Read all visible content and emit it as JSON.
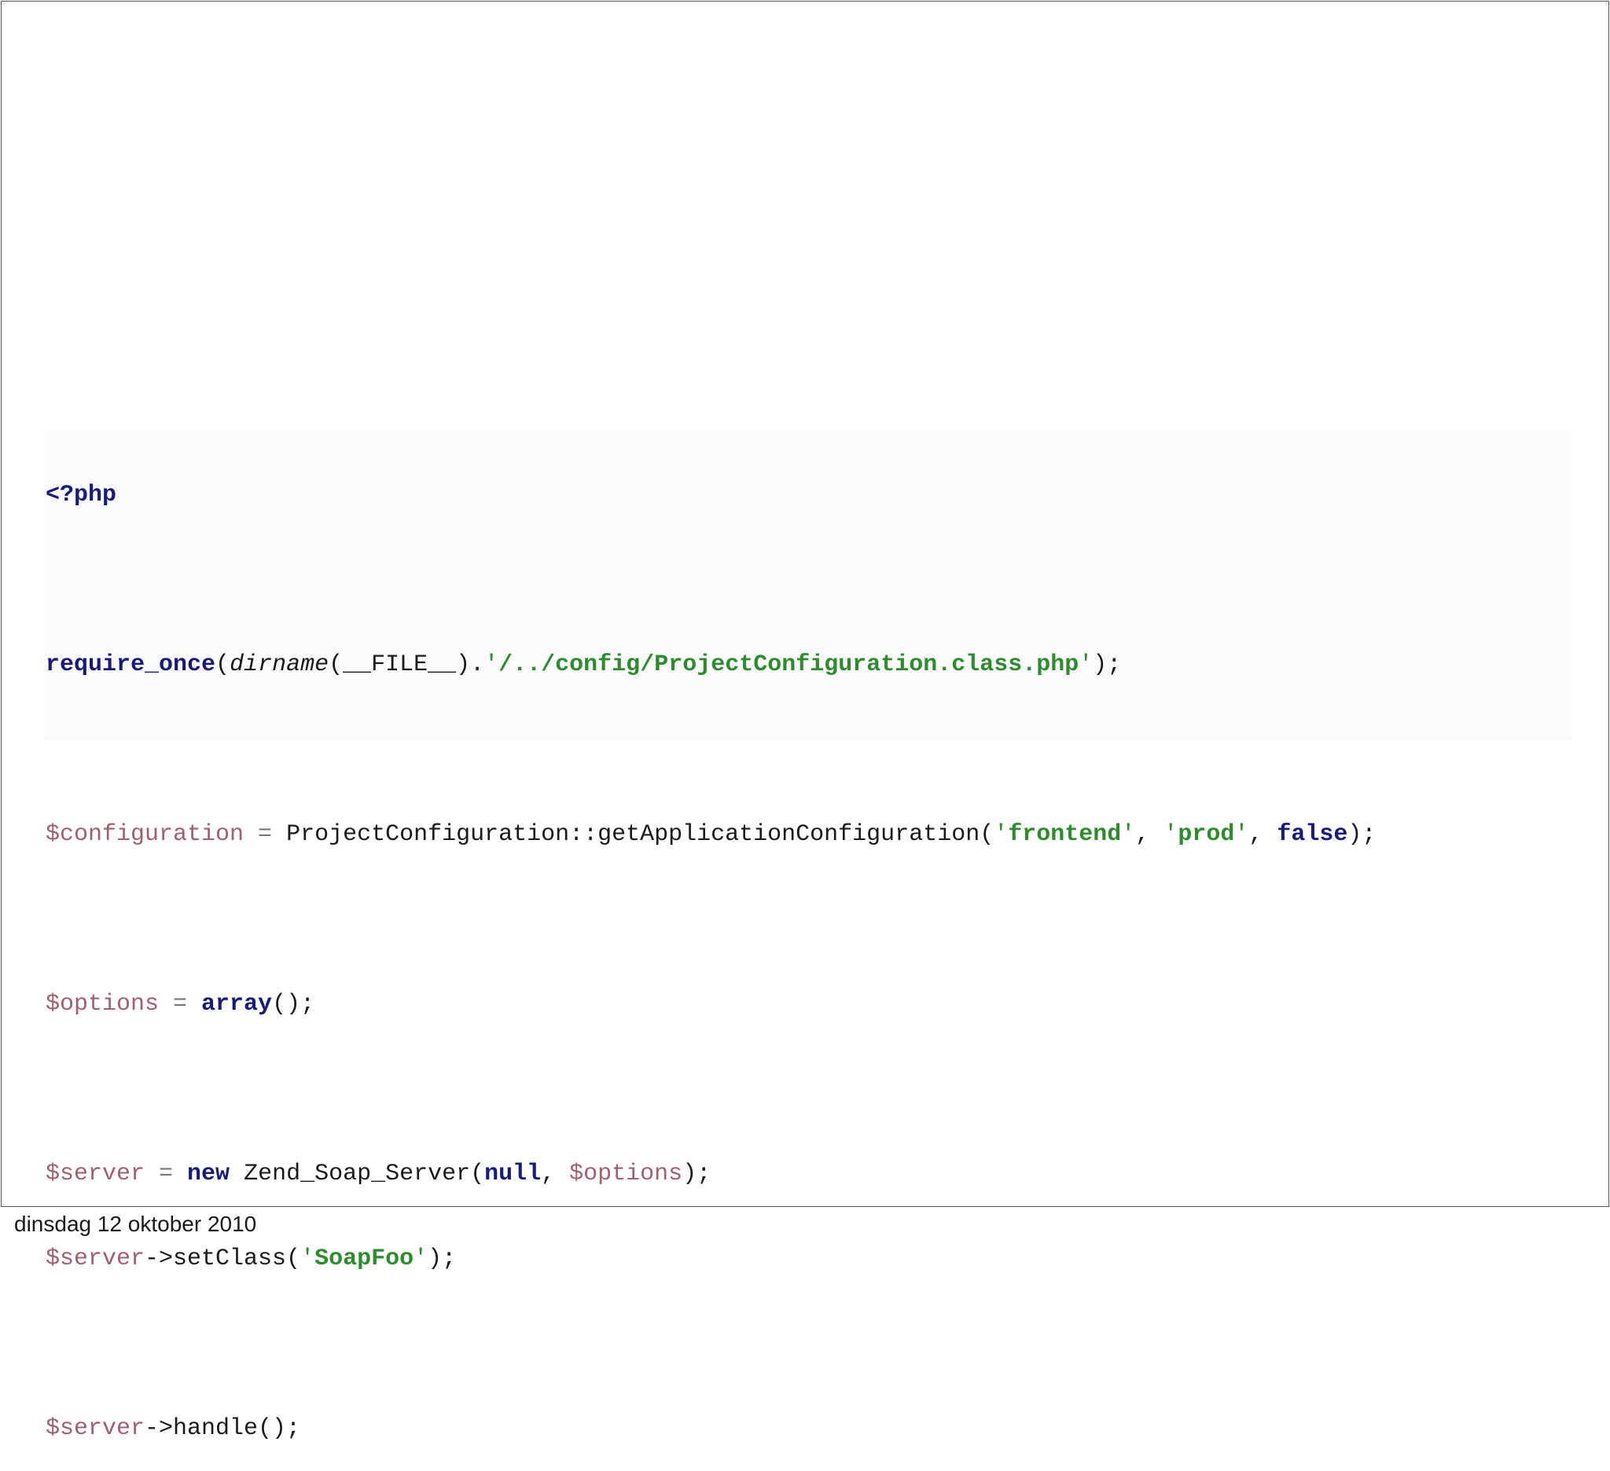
{
  "slide": {
    "footer_date": "dinsdag 12 oktober 2010"
  },
  "code": {
    "line1": {
      "open_tag": "<?php"
    },
    "line2": {
      "func": "require_once",
      "p1": "(",
      "inner_fn": "dirname",
      "p2": "(__FILE__).",
      "q1": "'",
      "path": "/../config/ProjectConfiguration.class.php",
      "q2": "'",
      "end": ");"
    },
    "line3": {
      "var": "$configuration",
      "eq": " = ",
      "call": "ProjectConfiguration::getApplicationConfiguration(",
      "q1": "'",
      "arg1": "frontend",
      "q2": "'",
      "comma1": ", ",
      "q3": "'",
      "arg2": "prod",
      "q4": "'",
      "comma2": ", ",
      "arg3": "false",
      "end": ");"
    },
    "line4": {
      "var": "$options",
      "eq": " = ",
      "kw": "array",
      "end": "();"
    },
    "line5": {
      "var": "$server",
      "eq": " = ",
      "kw": "new",
      "cls": " Zend_Soap_Server(",
      "arg1": "null",
      "comma": ", ",
      "arg2": "$options",
      "end": ");"
    },
    "line6": {
      "var": "$server",
      "call": "->setClass(",
      "q1": "'",
      "arg": "SoapFoo",
      "q2": "'",
      "end": ");"
    },
    "line7": {
      "var": "$server",
      "call": "->handle();"
    }
  }
}
